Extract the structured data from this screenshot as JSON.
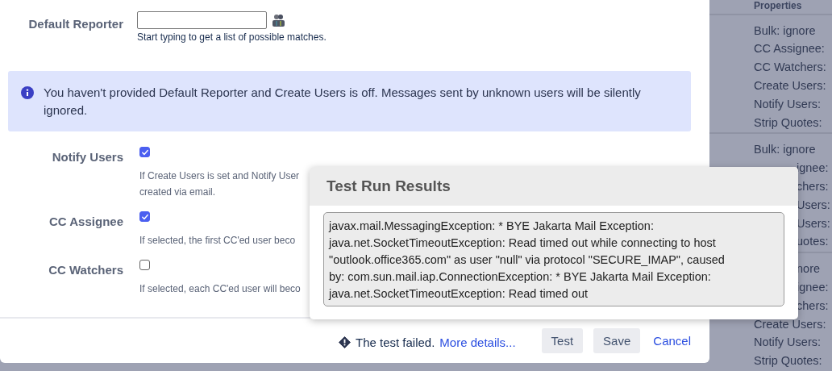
{
  "dialog": {
    "default_reporter": {
      "label": "Default Reporter",
      "hint": "Start typing to get a list of possible matches."
    },
    "info_message": "You haven't provided Default Reporter and Create Users is off. Messages sent by unknown users will be silently ignored.",
    "checkbox_fields": [
      {
        "label": "Notify Users",
        "checked": true,
        "description": [
          "If Create Users is set and Notify User",
          "created via email."
        ]
      },
      {
        "label": "CC Assignee",
        "checked": true,
        "description": [
          "If selected, the first CC'ed user beco"
        ]
      },
      {
        "label": "CC Watchers",
        "checked": false,
        "description": [
          "If selected, each CC'ed user will beco"
        ]
      }
    ],
    "footer": {
      "status": "The test failed.",
      "details_link": "More details...",
      "buttons": [
        "Test",
        "Save"
      ],
      "cancel_link": "Cancel"
    }
  },
  "test_results_popup": {
    "title": "Test Run Results",
    "output": [
      "javax.mail.MessagingException: * BYE Jakarta Mail Exception:",
      "java.net.SocketTimeoutException: Read timed out while connecting to host",
      "\"outlook.office365.com\" as user \"null\" via protocol \"SECURE_IMAP\", caused",
      "by: com.sun.mail.iap.ConnectionException: * BYE Jakarta Mail Exception:",
      "java.net.SocketTimeoutException: Read timed out"
    ]
  },
  "background_panel": {
    "heading": "Properties",
    "groups": [
      {
        "lines": [
          {
            "text": "Bulk: ignore",
            "covered": false
          },
          {
            "text": "CC Assignee:",
            "covered": false
          },
          {
            "text": "CC Watchers:",
            "covered": false
          },
          {
            "text": "Create Users:",
            "covered": false
          },
          {
            "text": "Notify Users:",
            "covered": false
          },
          {
            "text": "Strip Quotes:",
            "covered": false
          }
        ]
      },
      {
        "lines": [
          {
            "text": "Bulk: ignore",
            "covered": false
          },
          {
            "text": "ignee:",
            "covered": true
          },
          {
            "text": "chers:",
            "covered": true
          },
          {
            "text": "Users:",
            "covered": true
          },
          {
            "text": "Users:",
            "covered": true
          },
          {
            "text": "uotes:",
            "covered": true
          }
        ]
      },
      {
        "lines": [
          {
            "text": "nore",
            "covered": true
          },
          {
            "text": "ignee:",
            "covered": true
          },
          {
            "text": "chers:",
            "covered": true
          },
          {
            "text": "Create Users:",
            "covered": false
          },
          {
            "text": "Notify Users:",
            "covered": false
          },
          {
            "text": "Strip Quotes:",
            "covered": false
          }
        ]
      }
    ]
  }
}
